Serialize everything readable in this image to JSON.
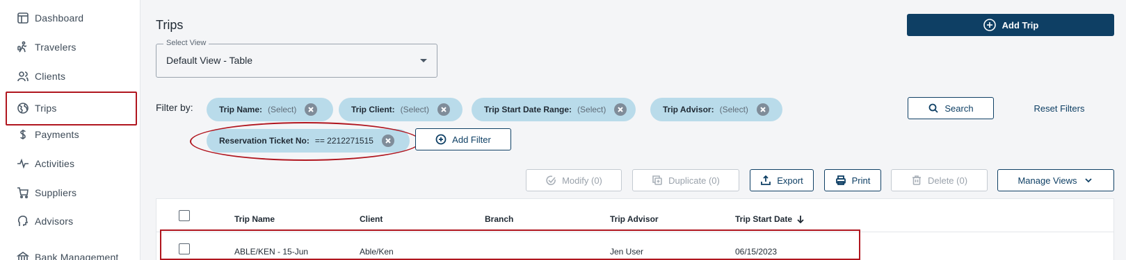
{
  "sidebar": {
    "items": [
      {
        "label": "Dashboard",
        "icon": "dashboard-icon"
      },
      {
        "label": "Travelers",
        "icon": "traveler-icon"
      },
      {
        "label": "Clients",
        "icon": "clients-icon"
      },
      {
        "label": "Trips",
        "icon": "globe-icon"
      },
      {
        "label": "Payments",
        "icon": "dollar-icon"
      },
      {
        "label": "Activities",
        "icon": "activity-icon"
      },
      {
        "label": "Suppliers",
        "icon": "cart-icon"
      },
      {
        "label": "Advisors",
        "icon": "advisor-icon"
      },
      {
        "label": "Bank Management",
        "icon": "bank-icon"
      }
    ]
  },
  "header": {
    "title": "Trips",
    "add_trip_label": "Add Trip"
  },
  "select_view": {
    "legend": "Select View",
    "value": "Default View - Table"
  },
  "filters": {
    "label": "Filter by:",
    "chips": [
      {
        "key": "Trip Name:",
        "value": "(Select)"
      },
      {
        "key": "Trip Client:",
        "value": "(Select)"
      },
      {
        "key": "Trip Start Date Range:",
        "value": "(Select)"
      },
      {
        "key": "Trip Advisor:",
        "value": "(Select)"
      },
      {
        "key": "Reservation Ticket No:",
        "value": "== 2212271515"
      }
    ],
    "add_filter_label": "Add Filter",
    "search_label": "Search",
    "reset_label": "Reset Filters"
  },
  "toolbar": {
    "modify_label": "Modify (0)",
    "duplicate_label": "Duplicate (0)",
    "export_label": "Export",
    "print_label": "Print",
    "delete_label": "Delete (0)",
    "manage_views_label": "Manage Views"
  },
  "table": {
    "columns": [
      "Trip Name",
      "Client",
      "Branch",
      "Trip Advisor",
      "Trip Start Date"
    ],
    "rows": [
      {
        "trip_name": "ABLE/KEN - 15-Jun",
        "client": "Able/Ken",
        "branch": "",
        "advisor": "Jen User",
        "start_date": "06/15/2023"
      }
    ]
  },
  "colors": {
    "primary": "#0e3f64",
    "chip": "#b9dbea",
    "highlight": "#b0151e"
  }
}
